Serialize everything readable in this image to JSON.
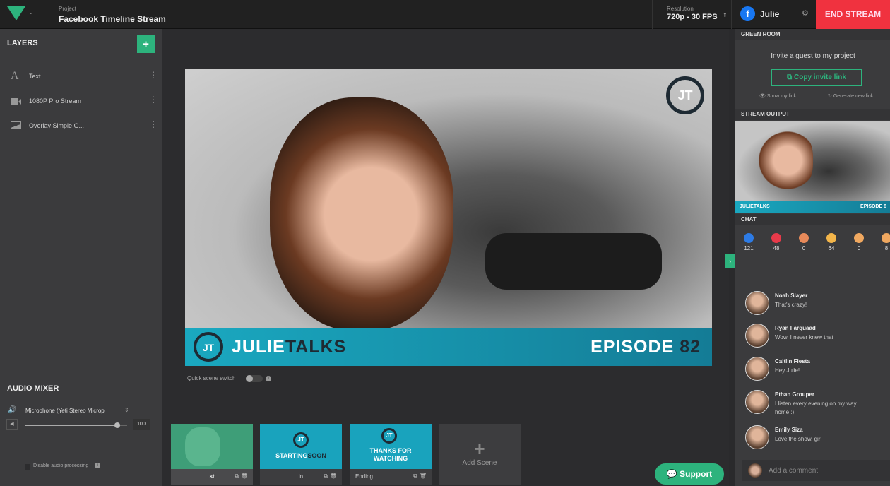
{
  "header": {
    "project_label": "Project",
    "project_name": "Facebook Timeline Stream",
    "resolution_label": "Resolution",
    "resolution_value": "720p - 30 FPS",
    "user": "Julie",
    "end_stream": "END STREAM",
    "brand_color": "#2db37d",
    "end_color": "#f0323f"
  },
  "layers": {
    "title": "LAYERS",
    "items": [
      {
        "label": "Text",
        "icon": "text-icon"
      },
      {
        "label": "1080P Pro Stream",
        "icon": "camera-icon"
      },
      {
        "label": "Overlay Simple G...",
        "icon": "image-icon"
      }
    ]
  },
  "audio": {
    "title": "AUDIO MIXER",
    "device": "Microphone (Yeti Stereo Micropl",
    "volume": "100",
    "volume_level": 0.9,
    "disable_label": "Disable audio processing"
  },
  "preview": {
    "badge": "JT",
    "show_first": "JULIE",
    "show_second": "TALKS",
    "episode_label": "EPISODE",
    "episode_number": "82",
    "quick_switch": "Quick scene switch"
  },
  "scenes": [
    {
      "name": "st"
    },
    {
      "name": "in",
      "title_a": "STARTING",
      "title_b": "SOON"
    },
    {
      "name": "Ending",
      "title_a": "THANKS FOR",
      "title_b": "WATCHING"
    }
  ],
  "add_scene": "Add Scene",
  "support": "Support",
  "green_room": {
    "title": "GREEN ROOM",
    "invite": "Invite a guest to my project",
    "copy": "Copy invite link",
    "show": "Show my link",
    "generate": "Generate new link"
  },
  "stream_output": {
    "title": "STREAM OUTPUT",
    "show": "JULIETALKS",
    "episode": "EPISODE 8"
  },
  "chat": {
    "title": "CHAT",
    "reactions": [
      {
        "icon": "like-icon",
        "count": "121",
        "color": "#2d7be5"
      },
      {
        "icon": "love-icon",
        "count": "48",
        "color": "#e83a4a"
      },
      {
        "icon": "haha-icon",
        "count": "0",
        "color": "#e88a5a"
      },
      {
        "icon": "laugh-icon",
        "count": "64",
        "color": "#f3b54a"
      },
      {
        "icon": "sad-icon",
        "count": "0",
        "color": "#f0a860"
      },
      {
        "icon": "wow-icon",
        "count": "8",
        "color": "#f0a860"
      }
    ],
    "messages": [
      {
        "name": "Noah Slayer",
        "text": "That's crazy!"
      },
      {
        "name": "Ryan Farquaad",
        "text": "Wow, I never knew that"
      },
      {
        "name": "Caitlin Fiesta",
        "text": "Hey Julie!"
      },
      {
        "name": "Ethan Grouper",
        "text": "I listen every evening on my way home :)"
      },
      {
        "name": "Emily Siza",
        "text": "Love the show, girl"
      }
    ],
    "placeholder": "Add a comment"
  }
}
